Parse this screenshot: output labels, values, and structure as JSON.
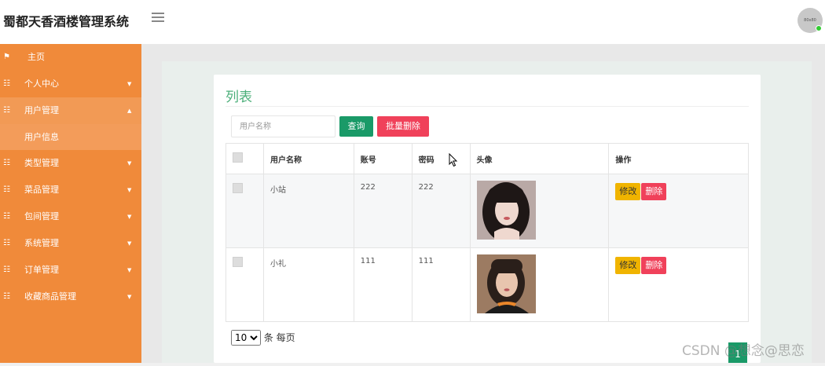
{
  "header": {
    "app_title": "蜀都天香酒楼管理系统",
    "avatar_text": "80x80"
  },
  "sidebar": {
    "items": [
      {
        "label": "主页"
      },
      {
        "label": "个人中心"
      },
      {
        "label": "用户管理",
        "children": [
          {
            "label": "用户信息"
          }
        ]
      },
      {
        "label": "类型管理"
      },
      {
        "label": "菜品管理"
      },
      {
        "label": "包间管理"
      },
      {
        "label": "系统管理"
      },
      {
        "label": "订单管理"
      },
      {
        "label": "收藏商品管理"
      }
    ]
  },
  "main": {
    "title": "列表",
    "search": {
      "placeholder": "用户名称",
      "value": ""
    },
    "query_label": "查询",
    "batch_delete_label": "批量删除",
    "table": {
      "columns": [
        "用户名称",
        "账号",
        "密码",
        "头像",
        "操作"
      ],
      "rows": [
        {
          "name": "小站",
          "account": "222",
          "password": "222",
          "avatar": "user-photo-1"
        },
        {
          "name": "小礼",
          "account": "111",
          "password": "111",
          "avatar": "user-photo-2"
        }
      ],
      "edit_label": "修改",
      "delete_label": "删除"
    },
    "pagination": {
      "page_size": "10",
      "per_page_label": "条 每页",
      "current_page": "1"
    }
  },
  "watermark": "CSDN @想念@思恋",
  "colors": {
    "sidebar": "#f08a3a",
    "accent_green": "#1a9a68",
    "danger": "#f0415a",
    "warning": "#f0b400",
    "title_green": "#4caf7a"
  }
}
